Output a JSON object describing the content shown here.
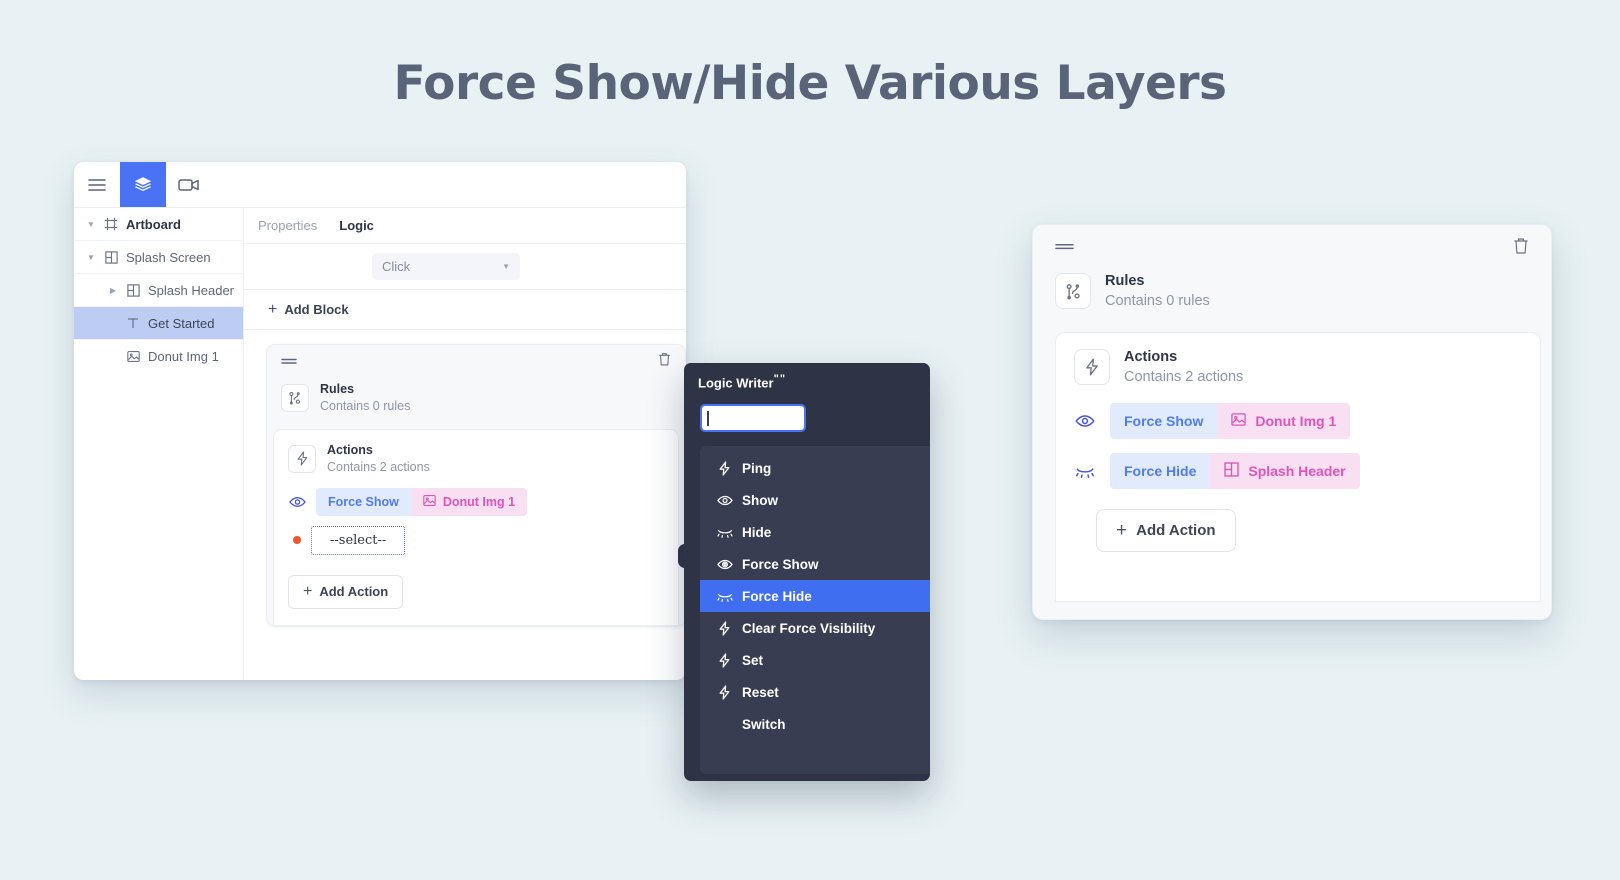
{
  "page": {
    "title": "Force Show/Hide Various Layers",
    "background_color": "#e8f2f4",
    "title_color": "#5a6478"
  },
  "editor": {
    "toolbar": {
      "menu_icon": "hamburger-menu-icon",
      "layers_icon": "layers-icon",
      "video_icon": "video-camera-icon",
      "active_tool": "layers",
      "active_color": "#4a72f5"
    },
    "layer_tree": [
      {
        "label": "Artboard",
        "icon": "artboard-icon",
        "indent": 0,
        "caret": "down",
        "selected": false,
        "bold": true
      },
      {
        "label": "Splash Screen",
        "icon": "frame-icon",
        "indent": 0,
        "caret": "down",
        "selected": false,
        "bold": false
      },
      {
        "label": "Splash Header",
        "icon": "frame-icon",
        "indent": 1,
        "caret": "right",
        "selected": false,
        "bold": false
      },
      {
        "label": "Get Started",
        "icon": "text-icon",
        "indent": 1,
        "caret": "none",
        "selected": true,
        "bold": false
      },
      {
        "label": "Donut Img 1",
        "icon": "image-icon",
        "indent": 1,
        "caret": "none",
        "selected": false,
        "bold": false
      }
    ],
    "tabs": [
      {
        "label": "Properties",
        "active": false
      },
      {
        "label": "Logic",
        "active": true
      }
    ],
    "trigger_select": {
      "value": "Click",
      "icon": "chevron-down-icon"
    },
    "add_block_label": "Add Block",
    "block": {
      "grip_icon": "drag-handle-icon",
      "trash_icon": "trash-icon",
      "rules": {
        "title": "Rules",
        "subtitle": "Contains 0 rules",
        "icon": "rules-branch-icon"
      },
      "actions": {
        "title": "Actions",
        "subtitle": "Contains 2 actions",
        "icon": "lightning-bolt-icon",
        "items": [
          {
            "state_icon": "eye-open-icon",
            "verb": "Force Show",
            "target": "Donut Img 1",
            "target_icon": "image-icon"
          }
        ],
        "pending_select": {
          "label": "--select--",
          "marker": "red-dot",
          "marker_color": "#f2532b"
        },
        "add_action_label": "Add Action"
      }
    }
  },
  "logic_writer": {
    "title": "Logic Writer",
    "title_suffix": "\"\"",
    "search_value": "",
    "options": [
      {
        "label": "Ping",
        "icon": "lightning-bolt-icon",
        "selected": false
      },
      {
        "label": "Show",
        "icon": "eye-open-icon",
        "selected": false
      },
      {
        "label": "Hide",
        "icon": "eye-closed-icon",
        "selected": false
      },
      {
        "label": "Force Show",
        "icon": "eye-open-icon",
        "selected": false
      },
      {
        "label": "Force Hide",
        "icon": "eye-closed-icon",
        "selected": true
      },
      {
        "label": "Clear Force Visibility",
        "icon": "lightning-bolt-icon",
        "selected": false
      },
      {
        "label": "Set",
        "icon": "lightning-bolt-icon",
        "selected": false
      },
      {
        "label": "Reset",
        "icon": "lightning-bolt-icon",
        "selected": false
      },
      {
        "label": "Switch",
        "icon": "none",
        "selected": false
      }
    ],
    "panel_color": "#2e3346",
    "list_color": "#383d52",
    "highlight_color": "#3f6ef0"
  },
  "result_card": {
    "grip_icon": "drag-handle-icon",
    "trash_icon": "trash-icon",
    "rules": {
      "title": "Rules",
      "subtitle": "Contains 0 rules",
      "icon": "rules-branch-icon"
    },
    "actions": {
      "title": "Actions",
      "subtitle": "Contains 2 actions",
      "icon": "lightning-bolt-icon",
      "items": [
        {
          "state_icon": "eye-open-icon",
          "verb": "Force Show",
          "target": "Donut Img 1",
          "target_icon": "image-icon"
        },
        {
          "state_icon": "eye-closed-icon",
          "verb": "Force Hide",
          "target": "Splash Header",
          "target_icon": "frame-icon"
        }
      ],
      "add_action_label": "Add Action"
    }
  },
  "colors": {
    "verb_chip_bg": "#e2ebfd",
    "verb_chip_fg": "#4f7bf0",
    "target_chip_bg": "#f9dff2",
    "target_chip_fg": "#e054b8",
    "selected_layer_bg": "#bcccf2"
  }
}
